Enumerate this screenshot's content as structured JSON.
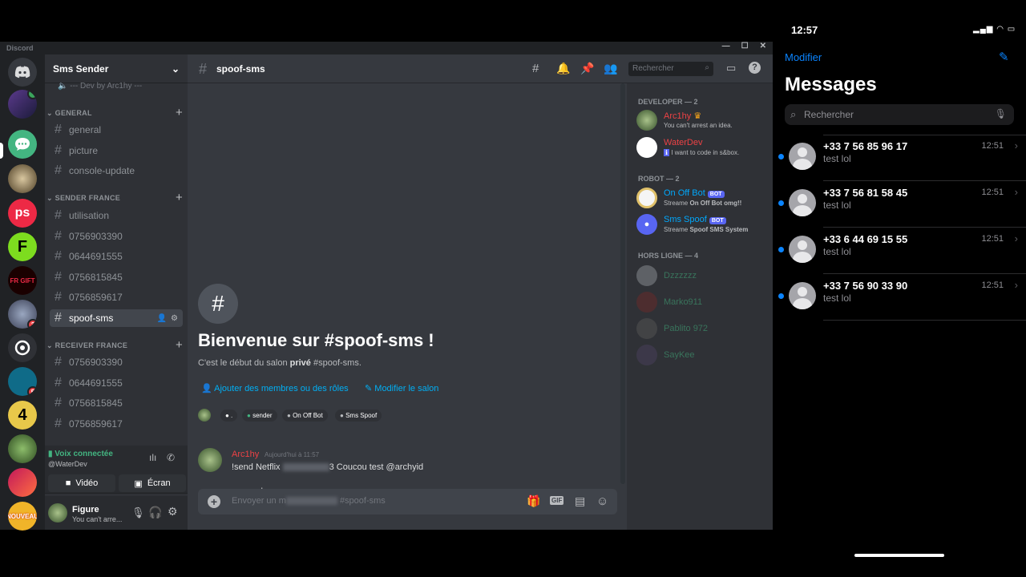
{
  "app": {
    "title": "Discord"
  },
  "server": {
    "name": "Sms Sender",
    "partial_item": "--- Dev by Arc1hy ---"
  },
  "categories": [
    {
      "name": "GENERAL",
      "channels": [
        "general",
        "picture",
        "console-update"
      ]
    },
    {
      "name": "SENDER FRANCE",
      "channels": [
        "utilisation",
        "0756903390",
        "0644691555",
        "0756815845",
        "0756859617",
        "spoof-sms"
      ]
    },
    {
      "name": "RECEIVER FRANCE",
      "channels": [
        "0756903390",
        "0644691555",
        "0756815845",
        "0756859617"
      ]
    }
  ],
  "active_channel": "spoof-sms",
  "guild_badges": {
    "g8": "3",
    "g11": "5"
  },
  "guild_texts": {
    "g4": "ps",
    "g5": "F",
    "g10": "4",
    "g13": "NOUVEAU"
  },
  "voice": {
    "status": "Voix connectée",
    "channel": "@WaterDev",
    "video": "Vidéo",
    "screen": "Écran"
  },
  "user": {
    "name": "Figure",
    "status": "You can't arre..."
  },
  "chat_header": {
    "channel": "spoof-sms",
    "search_placeholder": "Rechercher"
  },
  "welcome": {
    "title": "Bienvenue sur #spoof-sms !",
    "subtitle_pre": "C'est le début du salon ",
    "subtitle_bold": "privé",
    "subtitle_post": " #spoof-sms.",
    "add_members": "Ajouter des membres ou des rôles",
    "edit_channel": "Modifier le salon",
    "roles": [
      "sender",
      "On Off Bot",
      "Sms Spoof"
    ],
    "role_colors": [
      "#43b581",
      "#b9bbbe",
      "#b9bbbe"
    ]
  },
  "message": {
    "author": "Arc1hy",
    "timestamp": "Aujourd'hui à 11:57",
    "text_pre": "!send Netflix",
    "text_post": "3 Coucou test @archyid"
  },
  "composer": {
    "placeholder_pre": "Envoyer un m",
    "placeholder_post": "#spoof-sms"
  },
  "member_groups": [
    {
      "title": "DEVELOPER — 2",
      "members": [
        {
          "name": "Arc1hy",
          "status": "You can't arrest an idea.",
          "color": "#ed4245"
        },
        {
          "name": "WaterDev",
          "status": "I want to code in s&box.",
          "color": "#ed4245"
        }
      ]
    },
    {
      "title": "ROBOT — 2",
      "members": [
        {
          "name": "On Off Bot",
          "status_pre": "Streame ",
          "status_bold": "On Off Bot omg!!",
          "color": "#00a8fc",
          "badge": "BOT"
        },
        {
          "name": "Sms Spoof",
          "status_pre": "Streame ",
          "status_bold": "Spoof SMS System",
          "color": "#00a8fc",
          "badge": "BOT"
        }
      ]
    },
    {
      "title": "HORS LIGNE — 4",
      "members": [
        {
          "name": "Dzzzzzz",
          "color": "#3b5b3f"
        },
        {
          "name": "Marko911",
          "color": "#3b5b3f"
        },
        {
          "name": "Pablito 972",
          "color": "#3b5b3f"
        },
        {
          "name": "SayKee",
          "color": "#3b5b3f"
        }
      ]
    }
  ],
  "ios": {
    "time": "12:57",
    "edit": "Modifier",
    "title": "Messages",
    "search": "Rechercher",
    "conversations": [
      {
        "number": "+33 7 56 85 96 17",
        "preview": "test lol",
        "time": "12:51"
      },
      {
        "number": "+33 7 56 81 58 45",
        "preview": "test lol",
        "time": "12:51"
      },
      {
        "number": "+33 6 44 69 15 55",
        "preview": "test lol",
        "time": "12:51"
      },
      {
        "number": "+33 7 56 90 33 90",
        "preview": "test lol",
        "time": "12:51"
      }
    ]
  }
}
